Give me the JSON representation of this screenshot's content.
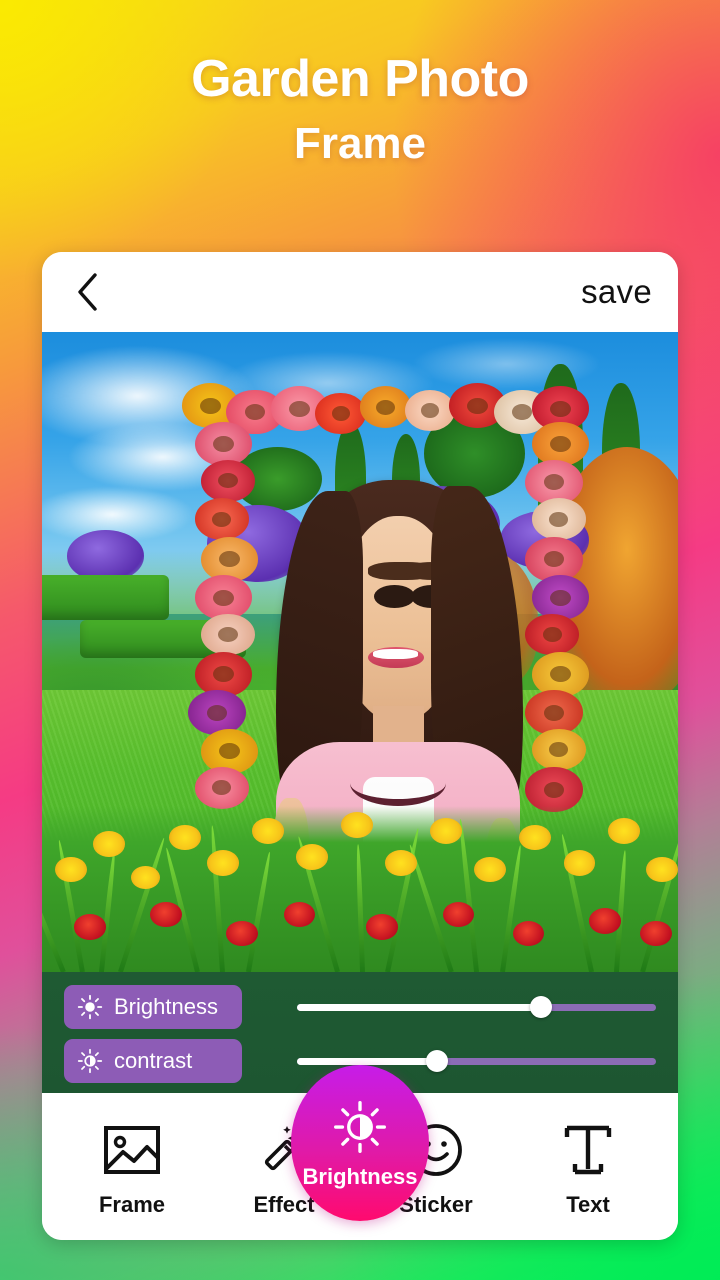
{
  "promo": {
    "line1": "Garden Photo",
    "line2": "Frame"
  },
  "appbar": {
    "back_label": "",
    "save_label": "save"
  },
  "photo": {
    "description": "Garden scene with blue sky, green hedges, purple and yellow flowers, a floral photo frame border, and a smiling woman in a pink jacket"
  },
  "adjust": {
    "controls": [
      {
        "label": "Brightness",
        "icon": "sun-icon",
        "value": 68,
        "min": 0,
        "max": 100
      },
      {
        "label": "contrast",
        "icon": "contrast-sun-icon",
        "value": 39,
        "min": 0,
        "max": 100
      }
    ]
  },
  "toolbar": {
    "items": [
      {
        "label": "Frame",
        "icon": "image-icon",
        "active": false
      },
      {
        "label": "Effect",
        "icon": "magic-wand-icon",
        "active": false
      },
      {
        "label": "Brightness",
        "icon": "brightness-sun-icon",
        "active": true
      },
      {
        "label": "Sticker",
        "icon": "smiley-icon",
        "active": false
      },
      {
        "label": "Text",
        "icon": "text-t-icon",
        "active": false
      }
    ]
  },
  "colors": {
    "gradient_top_left": "#f7dc13",
    "gradient_top_right": "#f5416c",
    "gradient_bottom": "#05f25c",
    "pill_purple": "#8d5cb6",
    "panel_green": "#1d5631",
    "active_gradient_start": "#c61ce8",
    "active_gradient_end": "#ff0a6e",
    "slider_fill": "#ffffff",
    "slider_track": "#8b6cb5"
  }
}
